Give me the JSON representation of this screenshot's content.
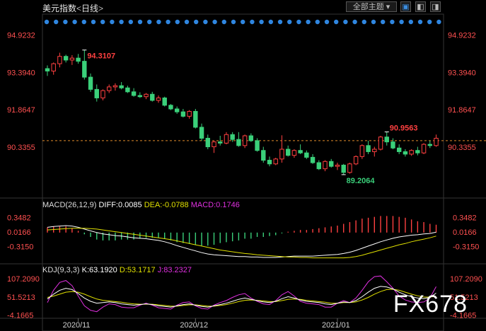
{
  "title": {
    "name": "美元指数",
    "open": "<",
    "period": "日线",
    "close": ">"
  },
  "toolbar": {
    "theme_label": "全部主题",
    "theme_arrow": "▾",
    "btn1": "▣",
    "btn2": "◧",
    "btn3": "◨"
  },
  "macd": {
    "label": "MACD(26,12,9)",
    "diff": "DIFF:0.0085",
    "dea": "DEA:-0.0788",
    "macd": "MACD:0.1746"
  },
  "kdj": {
    "label": "KDJ(9,3,3)",
    "k": "K:63.1920",
    "d": "D:53.1717",
    "j": "J:83.2327"
  },
  "watermark": "FX678",
  "colors": {
    "up": "#ff4040",
    "down": "#3ad07a",
    "diff": "#ffffff",
    "dea": "#e0e000",
    "j": "#e030e0",
    "bg": "#000000",
    "axis_text": "#ff5050"
  },
  "chart_data": [
    {
      "type": "candlestick",
      "title": "美元指数 日线",
      "y_ticks": [
        94.9232,
        93.394,
        91.8647,
        90.3355
      ],
      "ylim": [
        88.6,
        95.2
      ],
      "x_ticks": [
        "2020/11",
        "2020/12",
        "2021/01"
      ],
      "annotations": [
        {
          "text": "94.3107",
          "type": "high"
        },
        {
          "text": "89.2064",
          "type": "low"
        },
        {
          "text": "90.9563",
          "type": "high"
        }
      ],
      "last_price_line": 90.6,
      "ohlc": [
        [
          93.55,
          93.68,
          93.25,
          93.45
        ],
        [
          93.45,
          93.8,
          93.3,
          93.75
        ],
        [
          93.75,
          94.2,
          93.6,
          94.05
        ],
        [
          94.05,
          94.12,
          93.8,
          93.9
        ],
        [
          93.9,
          94.1,
          93.7,
          93.98
        ],
        [
          93.98,
          94.15,
          93.75,
          93.85
        ],
        [
          93.85,
          94.31,
          93.1,
          93.2
        ],
        [
          93.2,
          93.35,
          92.6,
          92.7
        ],
        [
          92.7,
          92.9,
          92.2,
          92.35
        ],
        [
          92.35,
          92.7,
          92.25,
          92.65
        ],
        [
          92.65,
          92.9,
          92.55,
          92.8
        ],
        [
          92.8,
          92.95,
          92.65,
          92.85
        ],
        [
          92.85,
          93.0,
          92.7,
          92.76
        ],
        [
          92.76,
          92.85,
          92.55,
          92.6
        ],
        [
          92.6,
          92.75,
          92.4,
          92.45
        ],
        [
          92.45,
          92.58,
          92.35,
          92.4
        ],
        [
          92.4,
          92.55,
          92.3,
          92.5
        ],
        [
          92.5,
          92.6,
          92.2,
          92.25
        ],
        [
          92.25,
          92.45,
          92.15,
          92.35
        ],
        [
          92.35,
          92.4,
          92.0,
          92.05
        ],
        [
          92.05,
          92.1,
          91.85,
          91.9
        ],
        [
          91.9,
          92.0,
          91.7,
          91.78
        ],
        [
          91.78,
          91.9,
          91.55,
          91.6
        ],
        [
          91.6,
          91.85,
          91.5,
          91.8
        ],
        [
          91.8,
          91.9,
          91.1,
          91.15
        ],
        [
          91.15,
          91.3,
          90.6,
          90.7
        ],
        [
          90.7,
          90.85,
          90.25,
          90.35
        ],
        [
          90.35,
          90.6,
          90.1,
          90.55
        ],
        [
          90.55,
          90.8,
          90.4,
          90.5
        ],
        [
          90.5,
          90.95,
          90.45,
          90.85
        ],
        [
          90.85,
          90.95,
          90.55,
          90.65
        ],
        [
          90.65,
          90.95,
          90.35,
          90.4
        ],
        [
          90.4,
          90.85,
          90.3,
          90.8
        ],
        [
          90.8,
          90.9,
          90.55,
          90.6
        ],
        [
          90.6,
          90.7,
          90.15,
          90.2
        ],
        [
          90.2,
          90.35,
          89.7,
          89.8
        ],
        [
          89.8,
          89.95,
          89.55,
          89.65
        ],
        [
          89.65,
          89.9,
          89.6,
          89.85
        ],
        [
          89.85,
          90.82,
          89.7,
          90.25
        ],
        [
          90.25,
          90.4,
          89.95,
          90.0
        ],
        [
          90.0,
          90.25,
          89.9,
          90.2
        ],
        [
          90.2,
          90.45,
          90.05,
          90.1
        ],
        [
          90.1,
          90.2,
          89.85,
          89.92
        ],
        [
          89.92,
          90.05,
          89.65,
          89.7
        ],
        [
          89.7,
          89.8,
          89.4,
          89.45
        ],
        [
          89.45,
          89.8,
          89.35,
          89.75
        ],
        [
          89.75,
          89.85,
          89.5,
          89.55
        ],
        [
          89.55,
          89.7,
          89.4,
          89.6
        ],
        [
          89.6,
          89.65,
          89.21,
          89.3
        ],
        [
          89.3,
          89.7,
          89.25,
          89.65
        ],
        [
          89.65,
          90.0,
          89.6,
          89.95
        ],
        [
          89.95,
          90.45,
          89.85,
          90.4
        ],
        [
          90.4,
          90.6,
          90.05,
          90.15
        ],
        [
          90.15,
          90.35,
          89.95,
          90.25
        ],
        [
          90.25,
          90.8,
          90.2,
          90.75
        ],
        [
          90.75,
          90.96,
          90.4,
          90.55
        ],
        [
          90.55,
          90.7,
          90.25,
          90.3
        ],
        [
          90.3,
          90.45,
          90.05,
          90.15
        ],
        [
          90.15,
          90.25,
          89.95,
          90.05
        ],
        [
          90.05,
          90.25,
          89.98,
          90.2
        ],
        [
          90.2,
          90.35,
          90.0,
          90.1
        ],
        [
          90.1,
          90.5,
          90.05,
          90.45
        ],
        [
          90.45,
          90.6,
          90.3,
          90.4
        ],
        [
          90.4,
          90.85,
          90.35,
          90.7
        ]
      ]
    },
    {
      "type": "macd",
      "params": "26,12,9",
      "y_ticks": [
        0.3482,
        0.0166,
        -0.315
      ],
      "ylim": [
        -0.7,
        0.5
      ],
      "diff": [
        0.12,
        0.14,
        0.15,
        0.16,
        0.15,
        0.12,
        0.08,
        0.04,
        0.0,
        -0.03,
        -0.05,
        -0.07,
        -0.08,
        -0.1,
        -0.12,
        -0.13,
        -0.14,
        -0.16,
        -0.18,
        -0.21,
        -0.25,
        -0.3,
        -0.34,
        -0.38,
        -0.42,
        -0.46,
        -0.49,
        -0.51,
        -0.52,
        -0.53,
        -0.54,
        -0.55,
        -0.55,
        -0.56,
        -0.56,
        -0.57,
        -0.57,
        -0.57,
        -0.56,
        -0.55,
        -0.54,
        -0.54,
        -0.54,
        -0.54,
        -0.53,
        -0.52,
        -0.51,
        -0.5,
        -0.48,
        -0.45,
        -0.41,
        -0.36,
        -0.31,
        -0.26,
        -0.21,
        -0.17,
        -0.13,
        -0.1,
        -0.08,
        -0.06,
        -0.05,
        -0.03,
        -0.02,
        0.01
      ],
      "dea": [
        0.06,
        0.07,
        0.08,
        0.09,
        0.1,
        0.1,
        0.1,
        0.09,
        0.08,
        0.06,
        0.04,
        0.02,
        0.0,
        -0.02,
        -0.04,
        -0.06,
        -0.08,
        -0.1,
        -0.12,
        -0.14,
        -0.16,
        -0.19,
        -0.22,
        -0.25,
        -0.28,
        -0.31,
        -0.34,
        -0.37,
        -0.4,
        -0.42,
        -0.44,
        -0.46,
        -0.48,
        -0.49,
        -0.51,
        -0.52,
        -0.53,
        -0.54,
        -0.55,
        -0.56,
        -0.56,
        -0.57,
        -0.57,
        -0.58,
        -0.58,
        -0.58,
        -0.58,
        -0.58,
        -0.58,
        -0.57,
        -0.55,
        -0.52,
        -0.48,
        -0.44,
        -0.4,
        -0.36,
        -0.32,
        -0.28,
        -0.25,
        -0.21,
        -0.18,
        -0.15,
        -0.12,
        -0.08
      ]
    },
    {
      "type": "kdj",
      "params": "9,3,3",
      "y_ticks": [
        107.209,
        51.5213,
        -4.1665
      ],
      "ylim": [
        -10,
        112
      ],
      "k": [
        45,
        60,
        72,
        78,
        74,
        62,
        48,
        38,
        32,
        34,
        36,
        34,
        30,
        28,
        26,
        28,
        30,
        28,
        24,
        22,
        20,
        24,
        28,
        30,
        26,
        22,
        20,
        24,
        28,
        32,
        38,
        44,
        48,
        44,
        40,
        36,
        34,
        38,
        46,
        52,
        48,
        42,
        38,
        36,
        34,
        30,
        28,
        32,
        36,
        34,
        40,
        52,
        66,
        78,
        84,
        82,
        76,
        66,
        58,
        52,
        48,
        46,
        50,
        63
      ],
      "d": [
        50,
        54,
        60,
        66,
        68,
        66,
        60,
        52,
        45,
        41,
        39,
        37,
        35,
        32,
        30,
        29,
        29,
        29,
        27,
        25,
        23,
        23,
        25,
        27,
        27,
        25,
        23,
        23,
        25,
        28,
        32,
        37,
        41,
        42,
        41,
        39,
        37,
        37,
        40,
        44,
        45,
        44,
        41,
        39,
        37,
        35,
        32,
        32,
        34,
        34,
        36,
        42,
        50,
        60,
        68,
        74,
        75,
        72,
        66,
        60,
        55,
        51,
        51,
        53
      ],
      "j": [
        34,
        72,
        96,
        102,
        86,
        54,
        24,
        10,
        6,
        20,
        30,
        28,
        20,
        18,
        18,
        26,
        32,
        26,
        18,
        16,
        14,
        26,
        34,
        36,
        24,
        16,
        14,
        26,
        34,
        40,
        50,
        58,
        62,
        48,
        38,
        30,
        28,
        40,
        58,
        68,
        54,
        38,
        32,
        30,
        28,
        20,
        20,
        32,
        40,
        34,
        48,
        72,
        98,
        114,
        116,
        98,
        78,
        54,
        42,
        36,
        34,
        36,
        48,
        83
      ]
    }
  ]
}
